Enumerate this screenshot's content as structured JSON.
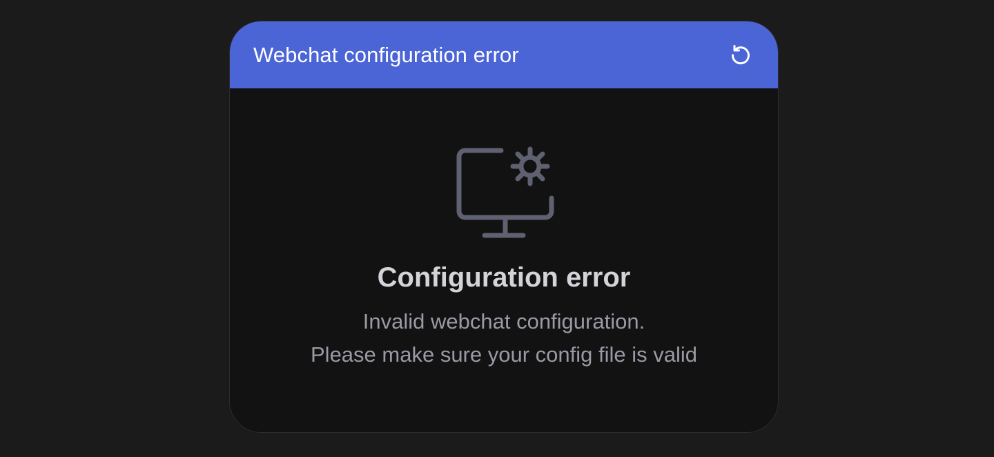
{
  "header": {
    "title": "Webchat configuration error",
    "refresh_icon": "refresh-icon"
  },
  "error": {
    "icon": "monitor-gear-icon",
    "title": "Configuration error",
    "message_line1": "Invalid webchat configuration.",
    "message_line2": "Please make sure your config file is valid"
  },
  "colors": {
    "accent": "#4b65d6",
    "background": "#1b1b1b",
    "panel": "#121212",
    "icon": "#5f6170"
  }
}
